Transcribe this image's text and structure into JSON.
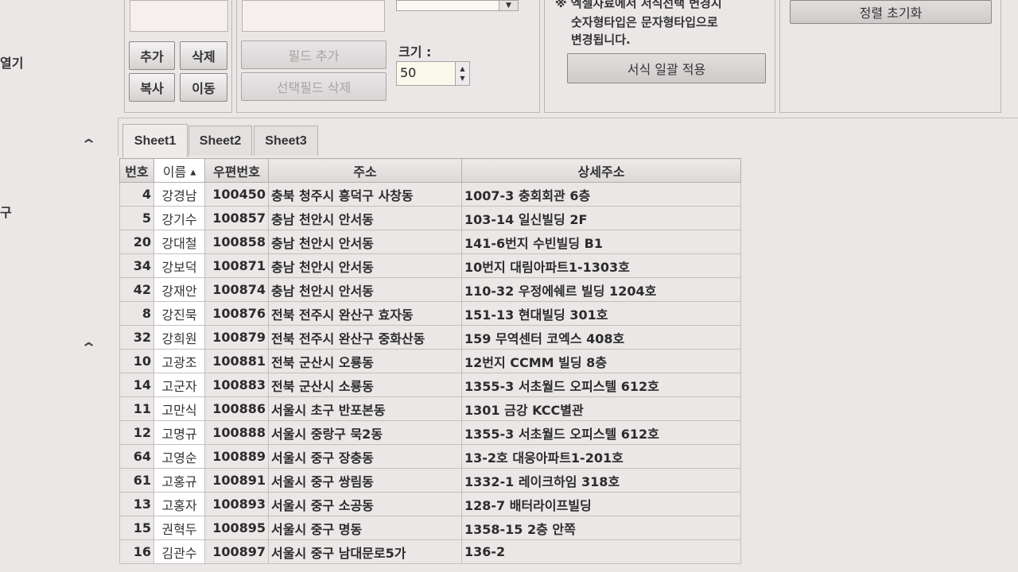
{
  "sidebar": {
    "label1": "열기",
    "label2": "구",
    "chevron1": "⌃",
    "chevron2": "⌃"
  },
  "group1": {
    "add": "추가",
    "delete": "삭제",
    "copy": "복사",
    "move": "이동"
  },
  "group2": {
    "add_field": "필드 추가",
    "delete_selected_field": "선택필드 삭제"
  },
  "group3": {
    "size_label": "크기 :",
    "size_value": "50"
  },
  "group4": {
    "note_line1": "※ 엑셀자료에서 서식선택 변경시",
    "note_line2": "숫자형타입은 문자형타입으로",
    "note_line3": "변경됩니다.",
    "apply_format": "서식 일괄 적용"
  },
  "group5": {
    "reset_sort": "정렬 초기화"
  },
  "tabs": [
    "Sheet1",
    "Sheet2",
    "Sheet3"
  ],
  "grid": {
    "columns": [
      "번호",
      "이름",
      "우편번호",
      "주소",
      "상세주소"
    ],
    "sort_indicator": "▲",
    "rows": [
      [
        "4",
        "강경남",
        "100450",
        "충북 청주시 흥덕구 사창동",
        "1007-3 충회회관 6층"
      ],
      [
        "5",
        "강기수",
        "100857",
        "충남 천안시 안서동",
        "103-14 일신빌딩 2F"
      ],
      [
        "20",
        "강대철",
        "100858",
        "충남 천안시 안서동",
        "141-6번지 수빈빌딩 B1"
      ],
      [
        "34",
        "강보덕",
        "100871",
        "충남 천안시 안서동",
        "10번지 대림아파트1-1303호"
      ],
      [
        "42",
        "강재안",
        "100874",
        "충남 천안시 안서동",
        "110-32 우정에쉐르 빌딩 1204호"
      ],
      [
        "8",
        "강진묵",
        "100876",
        "전북 전주시 완산구 효자동",
        "151-13 현대빌딩 301호"
      ],
      [
        "32",
        "강희원",
        "100879",
        "전북 전주시 완산구 중화산동",
        "159 무역센터 코엑스 408호"
      ],
      [
        "10",
        "고광조",
        "100881",
        "전북 군산시 오룡동",
        "12번지 CCMM 빌딩 8층"
      ],
      [
        "14",
        "고군자",
        "100883",
        "전북 군산시 소룡동",
        "1355-3 서초월드 오피스텔 612호"
      ],
      [
        "11",
        "고만식",
        "100886",
        "서울시 초구 반포본동",
        "1301 금강 KCC별관"
      ],
      [
        "12",
        "고명규",
        "100888",
        "서울시 중랑구 묵2동",
        "1355-3 서초월드 오피스텔 612호"
      ],
      [
        "64",
        "고영순",
        "100889",
        "서울시 중구 장충동",
        "13-2호 대웅아파트1-201호"
      ],
      [
        "61",
        "고홍규",
        "100891",
        "서울시 중구 쌍림동",
        "1332-1 레이크하임 318호"
      ],
      [
        "13",
        "고홍자",
        "100893",
        "서울시 중구 소공동",
        "128-7 배터라이프빌딩"
      ],
      [
        "15",
        "권혁두",
        "100895",
        "서울시 중구 명동",
        "1358-15 2층 안쪽"
      ],
      [
        "16",
        "김관수",
        "100897",
        "서울시 중구 남대문로5가",
        "136-2"
      ]
    ]
  }
}
